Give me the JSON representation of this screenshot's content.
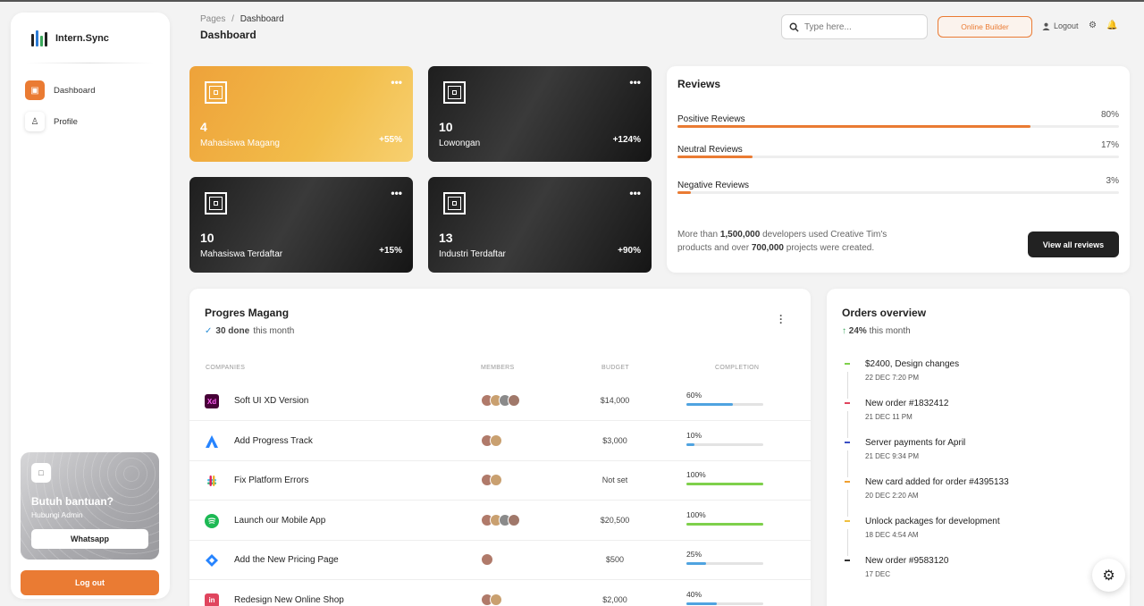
{
  "app": {
    "name": "Intern.Sync"
  },
  "sidebar": {
    "items": [
      {
        "label": "Dashboard",
        "icon": "shop-icon",
        "active": true
      },
      {
        "label": "Profile",
        "icon": "person-icon",
        "active": false
      }
    ],
    "help": {
      "title": "Butuh bantuan?",
      "subtitle": "Hubungi Admin",
      "button": "Whatsapp"
    },
    "logout": "Log out"
  },
  "header": {
    "breadcrumb_root": "Pages",
    "breadcrumb_sep": "/",
    "breadcrumb_current": "Dashboard",
    "title": "Dashboard",
    "search_placeholder": "Type here...",
    "builder_button": "Online Builder",
    "logout": "Logout"
  },
  "stats": [
    {
      "value": "4",
      "label": "Mahasiswa Magang",
      "change": "+55%",
      "theme": "orange"
    },
    {
      "value": "10",
      "label": "Lowongan",
      "change": "+124%",
      "theme": "dark"
    },
    {
      "value": "10",
      "label": "Mahasiswa Terdaftar",
      "change": "+15%",
      "theme": "dark"
    },
    {
      "value": "13",
      "label": "Industri Terdaftar",
      "change": "+90%",
      "theme": "dark"
    }
  ],
  "reviews": {
    "title": "Reviews",
    "rows": [
      {
        "label": "Positive Reviews",
        "percent": "80%",
        "value": 80
      },
      {
        "label": "Neutral Reviews",
        "percent": "17%",
        "value": 17
      },
      {
        "label": "Negative Reviews",
        "percent": "3%",
        "value": 3
      }
    ],
    "note_pre": "More than ",
    "note_b1": "1,500,000",
    "note_mid": " developers used Creative Tim's products and over ",
    "note_b2": "700,000",
    "note_post": " projects were created.",
    "button": "View all reviews"
  },
  "projects": {
    "title": "Progres Magang",
    "done_count": "30 done",
    "done_suffix": "this month",
    "columns": [
      "COMPANIES",
      "MEMBERS",
      "BUDGET",
      "COMPLETION"
    ],
    "rows": [
      {
        "name": "Soft UI XD Version",
        "icon": "Xd",
        "icon_color": "#470137",
        "members": 4,
        "budget": "$14,000",
        "completion": "60%",
        "value": 60,
        "bar": "#4fa3e0"
      },
      {
        "name": "Add Progress Track",
        "icon": "atlassian-icon",
        "icon_color": "#2684ff",
        "members": 2,
        "budget": "$3,000",
        "completion": "10%",
        "value": 10,
        "bar": "#4fa3e0"
      },
      {
        "name": "Fix Platform Errors",
        "icon": "slack-icon",
        "icon_color": "#e01e5a",
        "members": 2,
        "budget": "Not set",
        "completion": "100%",
        "value": 100,
        "bar": "#7ed04b"
      },
      {
        "name": "Launch our Mobile App",
        "icon": "spotify-icon",
        "icon_color": "#1db954",
        "members": 4,
        "budget": "$20,500",
        "completion": "100%",
        "value": 100,
        "bar": "#7ed04b"
      },
      {
        "name": "Add the New Pricing Page",
        "icon": "jira-icon",
        "icon_color": "#2684ff",
        "members": 1,
        "budget": "$500",
        "completion": "25%",
        "value": 25,
        "bar": "#4fa3e0"
      },
      {
        "name": "Redesign New Online Shop",
        "icon": "in",
        "icon_color": "#e0455e",
        "members": 2,
        "budget": "$2,000",
        "completion": "40%",
        "value": 40,
        "bar": "#4fa3e0"
      }
    ]
  },
  "orders": {
    "title": "Orders overview",
    "change": "24%",
    "change_suffix": "this month",
    "items": [
      {
        "title": "$2400, Design changes",
        "date": "22 DEC 7:20 PM",
        "color": "#7ed04b"
      },
      {
        "title": "New order #1832412",
        "date": "21 DEC 11 PM",
        "color": "#e0455e"
      },
      {
        "title": "Server payments for April",
        "date": "21 DEC 9:34 PM",
        "color": "#3a4fc4"
      },
      {
        "title": "New card added for order #4395133",
        "date": "20 DEC 2:20 AM",
        "color": "#f0a030"
      },
      {
        "title": "Unlock packages for development",
        "date": "18 DEC 4:54 AM",
        "color": "#f0c040"
      },
      {
        "title": "New order #9583120",
        "date": "17 DEC",
        "color": "#333333"
      }
    ]
  },
  "colors": {
    "accent": "#ea7b33",
    "dark_card": "#1e1e1e"
  }
}
